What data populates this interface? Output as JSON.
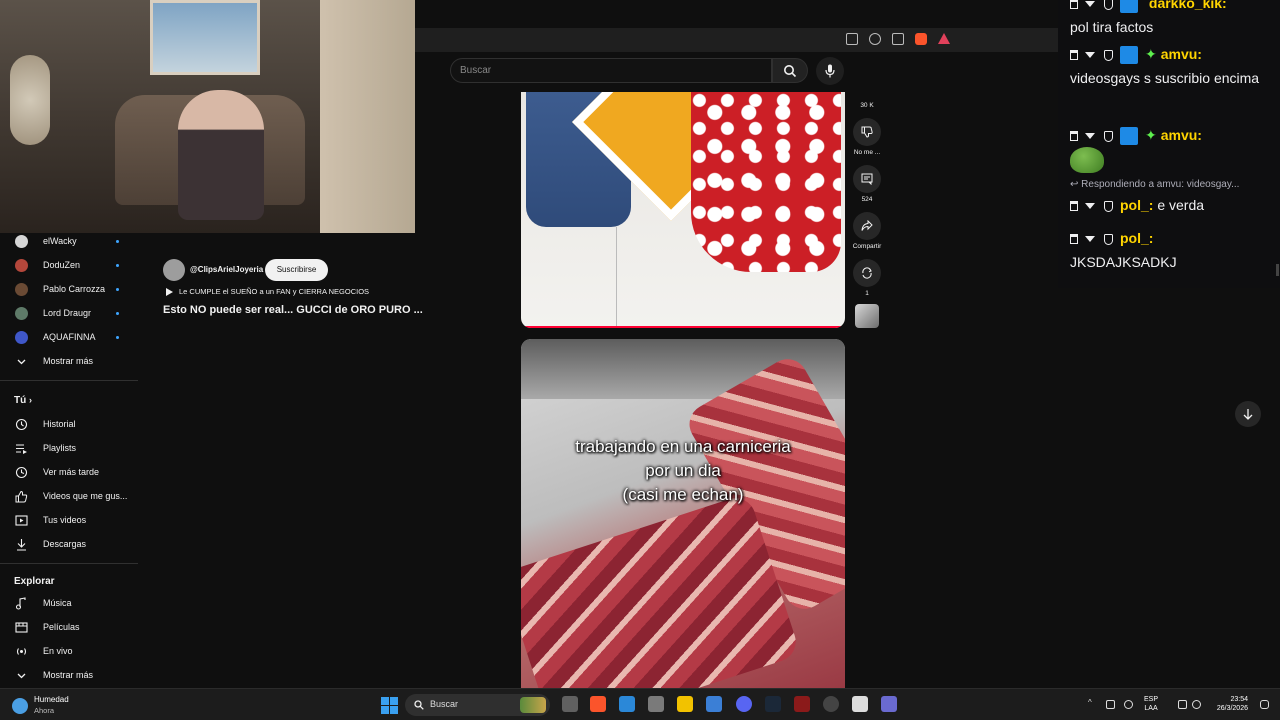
{
  "search": {
    "placeholder": "Buscar"
  },
  "sidebar": {
    "subscriptions": [
      {
        "name": "elWacky",
        "color": "#d6d6d6"
      },
      {
        "name": "DoduZen",
        "color": "#b4473b"
      },
      {
        "name": "Pablo Carrozza",
        "color": "#6a4a34"
      },
      {
        "name": "Lord Draugr",
        "color": "#5e7a68"
      },
      {
        "name": "AQUAFINNA",
        "color": "#3f57c9"
      }
    ],
    "show_more_subs": "Mostrar más",
    "you_section": "Tú",
    "you_items": [
      {
        "label": "Historial",
        "icon": "history-icon"
      },
      {
        "label": "Playlists",
        "icon": "playlists-icon"
      },
      {
        "label": "Ver más tarde",
        "icon": "watch-later-icon"
      },
      {
        "label": "Videos que me gus...",
        "icon": "liked-icon"
      },
      {
        "label": "Tus videos",
        "icon": "your-videos-icon"
      },
      {
        "label": "Descargas",
        "icon": "downloads-icon"
      }
    ],
    "explore_section": "Explorar",
    "explore_items": [
      {
        "label": "Música",
        "icon": "music-icon"
      },
      {
        "label": "Películas",
        "icon": "movies-icon"
      },
      {
        "label": "En vivo",
        "icon": "live-icon"
      }
    ],
    "show_more_explore": "Mostrar más"
  },
  "channel": {
    "handle": "@ClipsArielJoyeria",
    "subscribe_label": "Suscribirse",
    "song": "Le CUMPLE el SUEÑO a un FAN y CIERRA NEGOCIOS",
    "title": "Esto NO puede ser real... GUCCI de ORO PURO ..."
  },
  "short2": {
    "caption_lines": [
      "trabajando en una carniceria",
      "por un dia",
      "(casi me echan)"
    ]
  },
  "actions": {
    "likes": "30 K",
    "dislike_label": "No me ...",
    "comments": "524",
    "share_label": "Compartir",
    "remix_count": "1"
  },
  "chat": {
    "messages": [
      {
        "user": "darkko_kik:",
        "user_color": "#ffd400",
        "text": "pol tira factos"
      },
      {
        "user": "amvu:",
        "user_color": "#ffd400",
        "text": "videosgays s suscribio encima"
      },
      {
        "user": "amvu:",
        "user_color": "#ffd400",
        "text": ""
      },
      {
        "user": "pol_:",
        "user_color": "#ffd400",
        "text": "e verda"
      },
      {
        "user": "pol_:",
        "user_color": "#ffd400",
        "text": "JKSDAJKSADKJ"
      }
    ],
    "reply_context": "Respondiendo a amvu: videosgay..."
  },
  "taskbar": {
    "weather_title": "Humedad",
    "weather_sub": "Ahora",
    "search_label": "Buscar",
    "lang_line1": "ESP",
    "lang_line2": "LAA",
    "time": "23:54",
    "date": "26/3/2026"
  },
  "colors": {
    "accent_red": "#ff0033",
    "link_blue": "#3ea6ff",
    "chat_bg": "#0e0e10"
  }
}
